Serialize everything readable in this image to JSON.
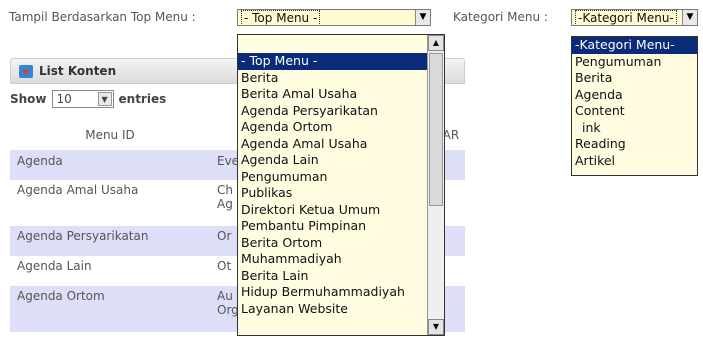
{
  "filters": {
    "top_menu_label": "Tampil Berdasarkan Top Menu :",
    "top_menu_selected": "- Top Menu -",
    "kategori_label": "Kategori Menu :",
    "kategori_selected": "-Kategori Menu-"
  },
  "panel": {
    "title": "List Konten"
  },
  "show": {
    "prefix": "Show",
    "value": "10",
    "suffix": "entries"
  },
  "table": {
    "headers": [
      "Menu ID",
      "",
      "Menu AR"
    ],
    "rows": [
      {
        "col1": "Agenda",
        "col2": "Eve"
      },
      {
        "col1": "Agenda Amal Usaha",
        "col2": "Ch\nAg"
      },
      {
        "col1": "Agenda Persyarikatan",
        "col2": "Or"
      },
      {
        "col1": "Agenda Lain",
        "col2": "Ot"
      },
      {
        "col1": "Agenda Ortom",
        "col2": "Au\nOrg"
      }
    ]
  },
  "top_menu_options": [
    "- Top Menu -",
    "Berita",
    "Berita Amal Usaha",
    "Agenda Persyarikatan",
    "Agenda Ortom",
    "Agenda Amal Usaha",
    "Agenda Lain",
    "Pengumuman",
    "Publikas",
    "Direktori Ketua Umum",
    "Pembantu Pimpinan",
    "Berita Ortom",
    "Muhammadiyah",
    "Berita Lain",
    "Hidup Bermuhammadiyah",
    "Layanan Website"
  ],
  "kategori_options": [
    "-Kategori Menu-",
    "Pengumuman",
    "Berita",
    "Agenda",
    "Content",
    "ink",
    "Reading",
    "Artikel"
  ]
}
